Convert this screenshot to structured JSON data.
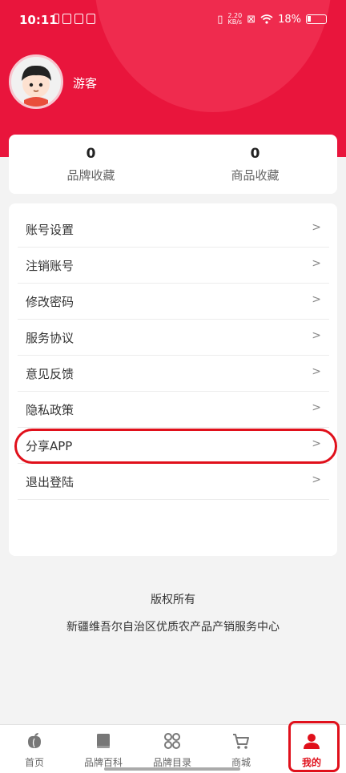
{
  "status_bar": {
    "time": "10:11",
    "speed_value": "2.20",
    "speed_unit": "KB/s",
    "battery": "18%"
  },
  "profile": {
    "name": "游客"
  },
  "stats": [
    {
      "value": "0",
      "label": "品牌收藏"
    },
    {
      "value": "0",
      "label": "商品收藏"
    }
  ],
  "menu": [
    {
      "label": "账号设置",
      "arrow": ">"
    },
    {
      "label": "注销账号",
      "arrow": ">"
    },
    {
      "label": "修改密码",
      "arrow": ">"
    },
    {
      "label": "服务协议",
      "arrow": ">"
    },
    {
      "label": "意见反馈",
      "arrow": ">"
    },
    {
      "label": "隐私政策",
      "arrow": ">"
    },
    {
      "label": "分享APP",
      "arrow": ">"
    },
    {
      "label": "退出登陆",
      "arrow": ">"
    }
  ],
  "footer": {
    "copyright": "版权所有",
    "organization": "新疆维吾尔自治区优质农产品产销服务中心"
  },
  "tabs": [
    {
      "label": "首页",
      "icon": "peach-icon"
    },
    {
      "label": "品牌百科",
      "icon": "book-icon"
    },
    {
      "label": "品牌目录",
      "icon": "grid-icon"
    },
    {
      "label": "商城",
      "icon": "cart-icon"
    },
    {
      "label": "我的",
      "icon": "user-icon",
      "active": true
    }
  ],
  "colors": {
    "brand": "#e9153c",
    "highlight": "#e0101b"
  }
}
